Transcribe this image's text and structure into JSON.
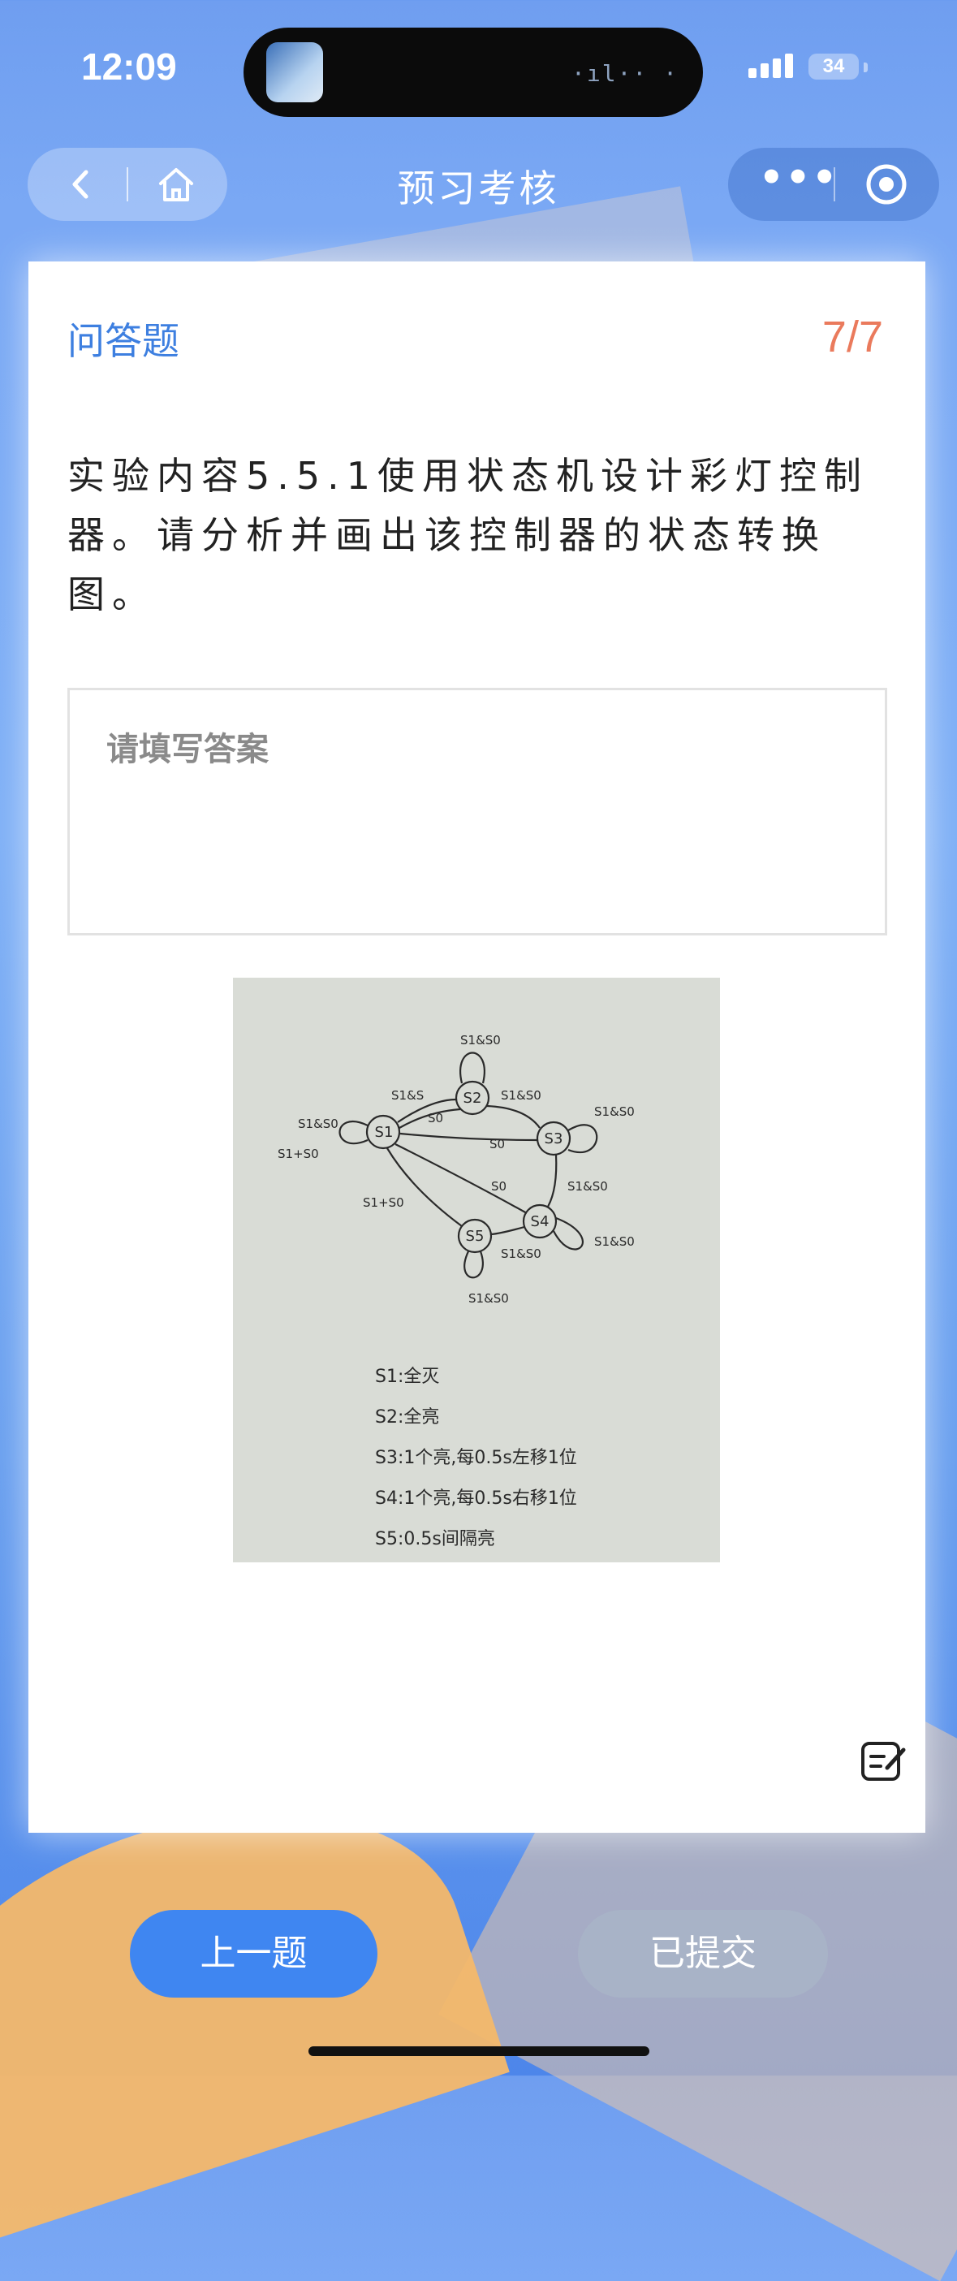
{
  "status_bar": {
    "time": "12:09",
    "battery": "34",
    "island_wave": "·ıl·· ·"
  },
  "nav": {
    "title": "预习考核"
  },
  "question": {
    "type": "问答题",
    "count": "7/7",
    "text": "实验内容5.5.1使用状态机设计彩灯控制器。请分析并画出该控制器的状态转换图。"
  },
  "answer": {
    "placeholder": "请填写答案"
  },
  "diagram": {
    "states": [
      "S1",
      "S2",
      "S3",
      "S4",
      "S5"
    ],
    "transitions": {
      "s2_self": "S1&S0",
      "s1_s2": "S1&S",
      "s2_s3": "S1&S0",
      "s3_self": "S1&S0",
      "s1_self_a": "S1&S0",
      "s1_self_b": "S1+S0",
      "s2_s1": "S0",
      "s3_s1": "S0",
      "s3_s4": "S1&S0",
      "s4_s1": "S0",
      "s4_self": "S1&S0",
      "s5_s1": "S1+S0",
      "s4_s5": "S1&S0",
      "s5_self": "S1&S0"
    },
    "legend": [
      "S1:全灭",
      "S2:全亮",
      "S3:1个亮,每0.5s左移1位",
      "S4:1个亮,每0.5s右移1位",
      "S5:0.5s间隔亮"
    ]
  },
  "buttons": {
    "prev": "上一题",
    "submitted": "已提交"
  }
}
